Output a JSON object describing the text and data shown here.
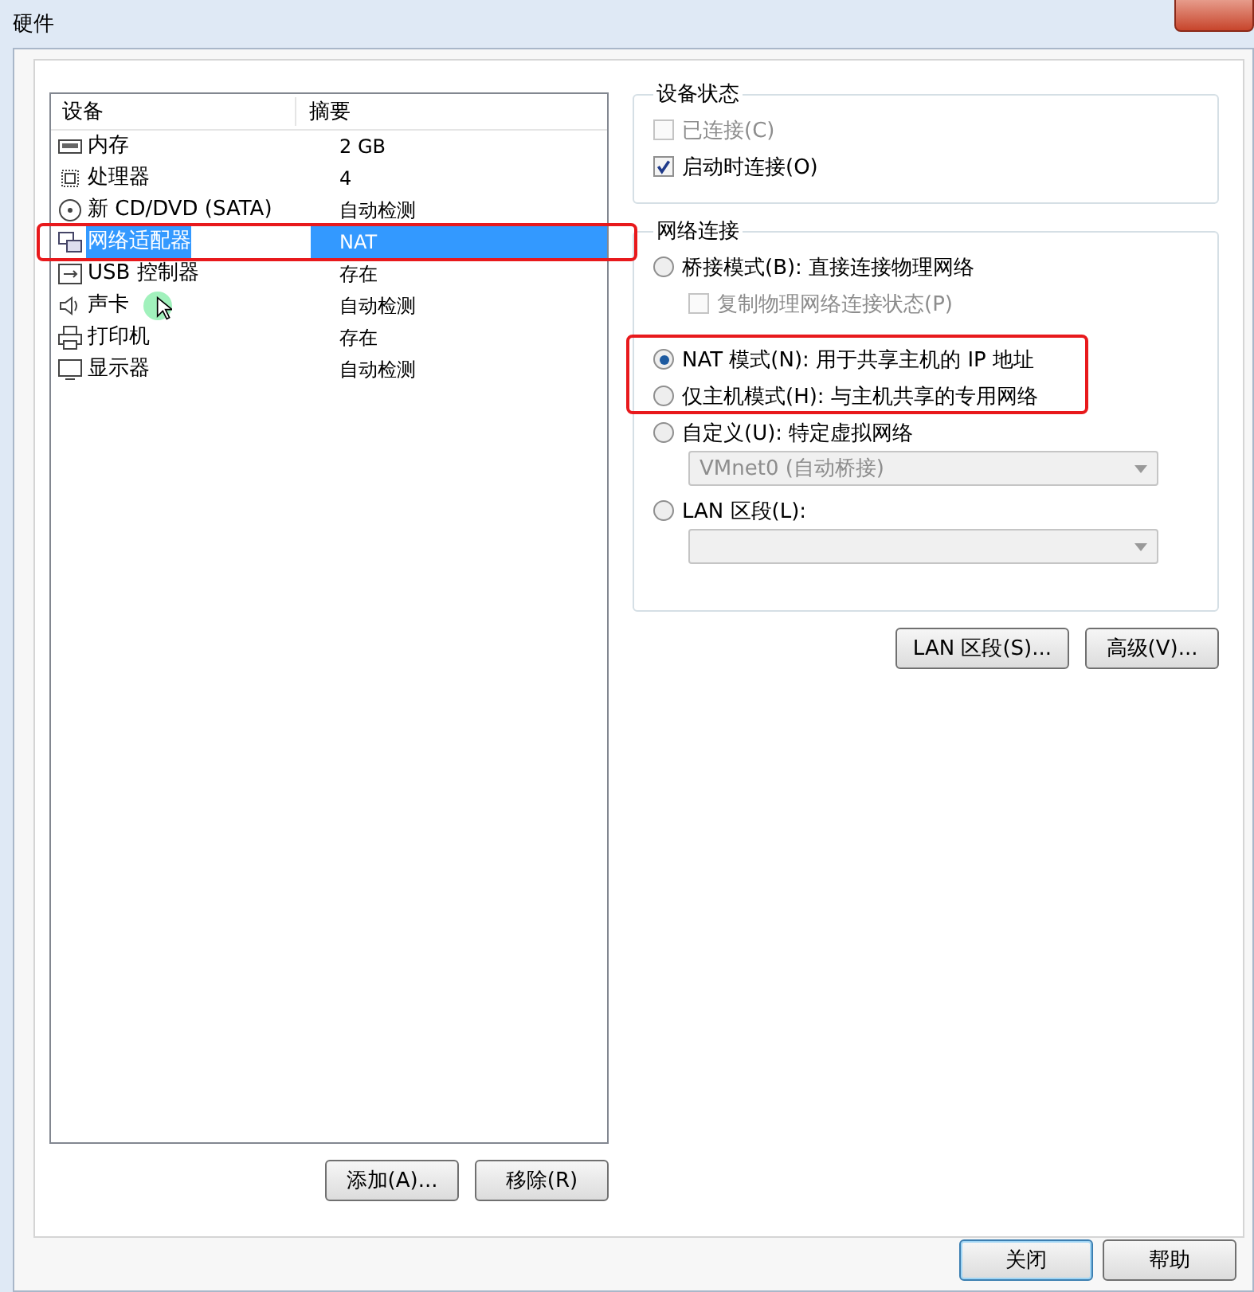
{
  "window": {
    "title": "硬件"
  },
  "device_list": {
    "columns": [
      "设备",
      "摘要"
    ],
    "rows": [
      {
        "name": "内存",
        "summary": "2 GB",
        "selected": false
      },
      {
        "name": "处理器",
        "summary": "4",
        "selected": false
      },
      {
        "name": "新 CD/DVD (SATA)",
        "summary": "自动检测",
        "selected": false
      },
      {
        "name": "网络适配器",
        "summary": "NAT",
        "selected": true
      },
      {
        "name": "USB 控制器",
        "summary": "存在",
        "selected": false
      },
      {
        "name": "声卡",
        "summary": "自动检测",
        "selected": false
      },
      {
        "name": "打印机",
        "summary": "存在",
        "selected": false
      },
      {
        "name": "显示器",
        "summary": "自动检测",
        "selected": false
      }
    ],
    "buttons": [
      "添加(A)...",
      "移除(R)"
    ]
  },
  "device_status": {
    "title": "设备状态",
    "checkboxes": [
      {
        "label": "已连接(C)",
        "checked": false,
        "disabled": true
      },
      {
        "label": "启动时连接(O)",
        "checked": true,
        "disabled": false
      }
    ]
  },
  "network_connection": {
    "title": "网络连接",
    "items": [
      {
        "kind": "radio",
        "label": "桥接模式(B): 直接连接物理网络",
        "selected": false,
        "disabled": false
      },
      {
        "kind": "checkbox",
        "label": "复制物理网络连接状态(P)",
        "checked": false,
        "disabled": true
      },
      {
        "kind": "radio",
        "label": "NAT 模式(N): 用于共享主机的 IP 地址",
        "selected": true,
        "disabled": false
      },
      {
        "kind": "radio",
        "label": "仅主机模式(H): 与主机共享的专用网络",
        "selected": false,
        "disabled": false
      },
      {
        "kind": "radio",
        "label": "自定义(U): 特定虚拟网络",
        "selected": false,
        "disabled": false
      },
      {
        "kind": "dropdown",
        "value": "VMnet0 (自动桥接)",
        "disabled": true
      },
      {
        "kind": "radio",
        "label": "LAN 区段(L):",
        "selected": false,
        "disabled": false
      },
      {
        "kind": "dropdown",
        "disabled": true
      }
    ]
  },
  "panel_buttons": [
    "LAN 区段(S)...",
    "高级(V)..."
  ],
  "footer_buttons": [
    {
      "label": "关闭",
      "default": true
    },
    {
      "label": "帮助",
      "default": false
    }
  ]
}
